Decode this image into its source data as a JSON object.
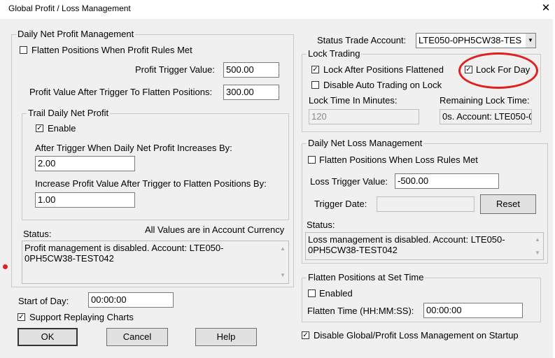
{
  "window": {
    "title": "Global Profit / Loss Management",
    "close_glyph": "✕"
  },
  "profit": {
    "legend": "Daily Net Profit Management",
    "flatten_label": "Flatten Positions When Profit Rules Met",
    "flatten_checked": false,
    "trigger_label": "Profit Trigger Value:",
    "trigger_value": "500.00",
    "after_label": "Profit Value After Trigger To Flatten Positions:",
    "after_value": "300.00",
    "trail": {
      "legend": "Trail Daily Net Profit",
      "enable_label": "Enable",
      "enable_checked": true,
      "increase_label": "After Trigger When Daily Net Profit Increases By:",
      "increase_value": "2.00",
      "flatten_by_label": "Increase Profit Value After Trigger to Flatten Positions By:",
      "flatten_by_value": "1.00"
    },
    "status_label": "Status:",
    "currency_note": "All Values are in Account Currency",
    "status_text": "Profit management is disabled. Account: LTE050-0PH5CW38-TEST042"
  },
  "start_of_day": {
    "label": "Start of Day:",
    "value": "00:00:00"
  },
  "replay": {
    "label": "Support Replaying Charts",
    "checked": true
  },
  "buttons": {
    "ok": "OK",
    "cancel": "Cancel",
    "help": "Help",
    "reset": "Reset"
  },
  "status_account": {
    "label": "Status Trade Account:",
    "value": "LTE050-0PH5CW38-TES"
  },
  "lock": {
    "legend": "Lock Trading",
    "after_flattened_label": "Lock After Positions Flattened",
    "after_flattened_checked": true,
    "lock_for_day_label": "Lock For Day",
    "lock_for_day_checked": true,
    "disable_auto_label": "Disable Auto Trading on Lock",
    "disable_auto_checked": false,
    "time_label": "Lock Time In Minutes:",
    "time_value": "120",
    "remaining_label": "Remaining Lock Time:",
    "remaining_value": "0s. Account: LTE050-0"
  },
  "loss": {
    "legend": "Daily Net Loss Management",
    "flatten_label": "Flatten Positions When Loss Rules Met",
    "flatten_checked": false,
    "trigger_label": "Loss Trigger Value:",
    "trigger_value": "-500.00",
    "date_label": "Trigger Date:",
    "date_value": "",
    "status_label": "Status:",
    "status_text": "Loss management is disabled. Account: LTE050-0PH5CW38-TEST042"
  },
  "flatten_time": {
    "legend": "Flatten Positions at Set Time",
    "enabled_label": "Enabled",
    "enabled_checked": false,
    "time_label": "Flatten Time (HH:MM:SS):",
    "time_value": "00:00:00"
  },
  "startup": {
    "label": "Disable Global/Profit Loss Management on Startup",
    "checked": true
  },
  "colors": {
    "highlight_circle": "#e02020",
    "panel_bg": "#f0f0f0"
  },
  "icons": {
    "check": "check-icon",
    "dropdown": "dropdown-arrow-icon",
    "scroll_up": "scroll-up-icon",
    "scroll_down": "scroll-down-icon",
    "close": "close-icon"
  }
}
